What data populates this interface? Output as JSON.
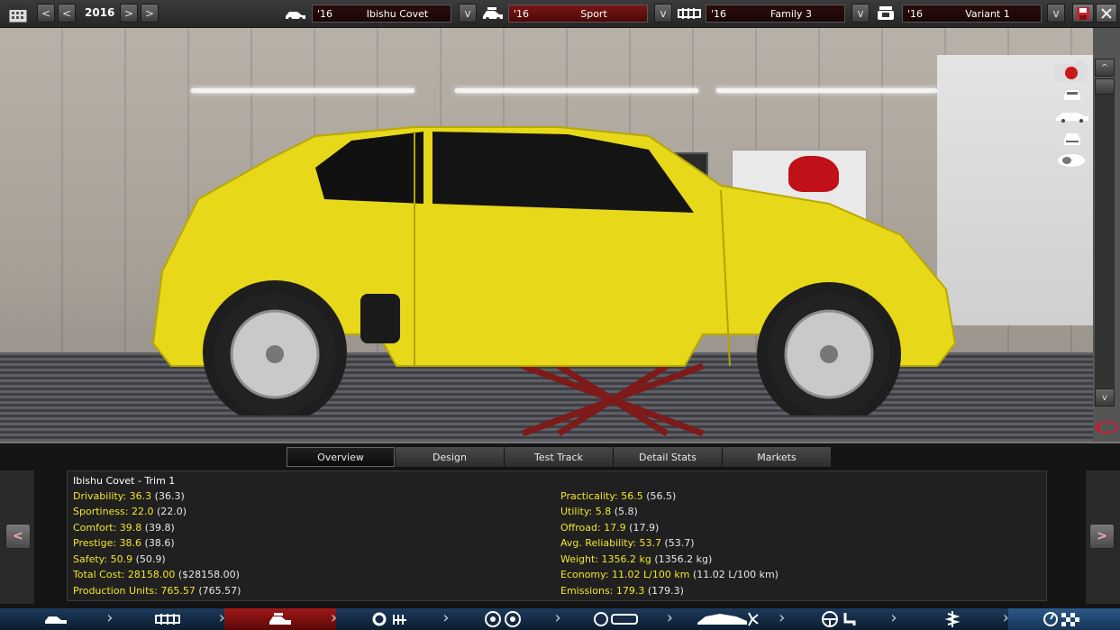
{
  "toolbar": {
    "year": "2016",
    "prev_label": "<",
    "next_label": ">",
    "car": {
      "year": "'16",
      "name": "Ibishu Covet"
    },
    "trim": {
      "year": "'16",
      "name": "Sport"
    },
    "family": {
      "year": "'16",
      "name": "Family 3"
    },
    "variant": {
      "year": "'16",
      "name": "Variant 1"
    },
    "dropdown_label": "v"
  },
  "scroll": {
    "up": "^",
    "down": "v"
  },
  "tabs": [
    "Overview",
    "Design",
    "Test Track",
    "Detail Stats",
    "Markets"
  ],
  "panel": {
    "title": "Ibishu Covet - Trim 1",
    "left_stats": [
      {
        "label": "Drivability: 36.3",
        "paren": "(36.3)"
      },
      {
        "label": "Sportiness: 22.0",
        "paren": "(22.0)"
      },
      {
        "label": "Comfort: 39.8",
        "paren": "(39.8)"
      },
      {
        "label": "Prestige: 38.6",
        "paren": "(38.6)"
      },
      {
        "label": "Safety: 50.9",
        "paren": "(50.9)"
      },
      {
        "label": "Total Cost: 28158.00",
        "paren": "($28158.00)"
      },
      {
        "label": "Production Units: 765.57",
        "paren": "(765.57)"
      }
    ],
    "right_stats": [
      {
        "label": "Practicality: 56.5",
        "paren": "(56.5)"
      },
      {
        "label": "Utility: 5.8",
        "paren": "(5.8)"
      },
      {
        "label": "Offroad: 17.9",
        "paren": "(17.9)"
      },
      {
        "label": "Avg. Reliability: 53.7",
        "paren": "(53.7)"
      },
      {
        "label": "Weight: 1356.2 kg",
        "paren": "(1356.2 kg)"
      },
      {
        "label": "Economy: 11.02 L/100 km",
        "paren": "(11.02 L/100 km)"
      },
      {
        "label": "Emissions: 179.3",
        "paren": "(179.3)"
      }
    ],
    "prev_arrow": "<",
    "next_arrow": ">"
  },
  "colors": {
    "car": "#e8d81a",
    "stat_label": "#f2e62b",
    "active_red": "#8a1010",
    "bottom_bar": "#1d3a5c"
  }
}
